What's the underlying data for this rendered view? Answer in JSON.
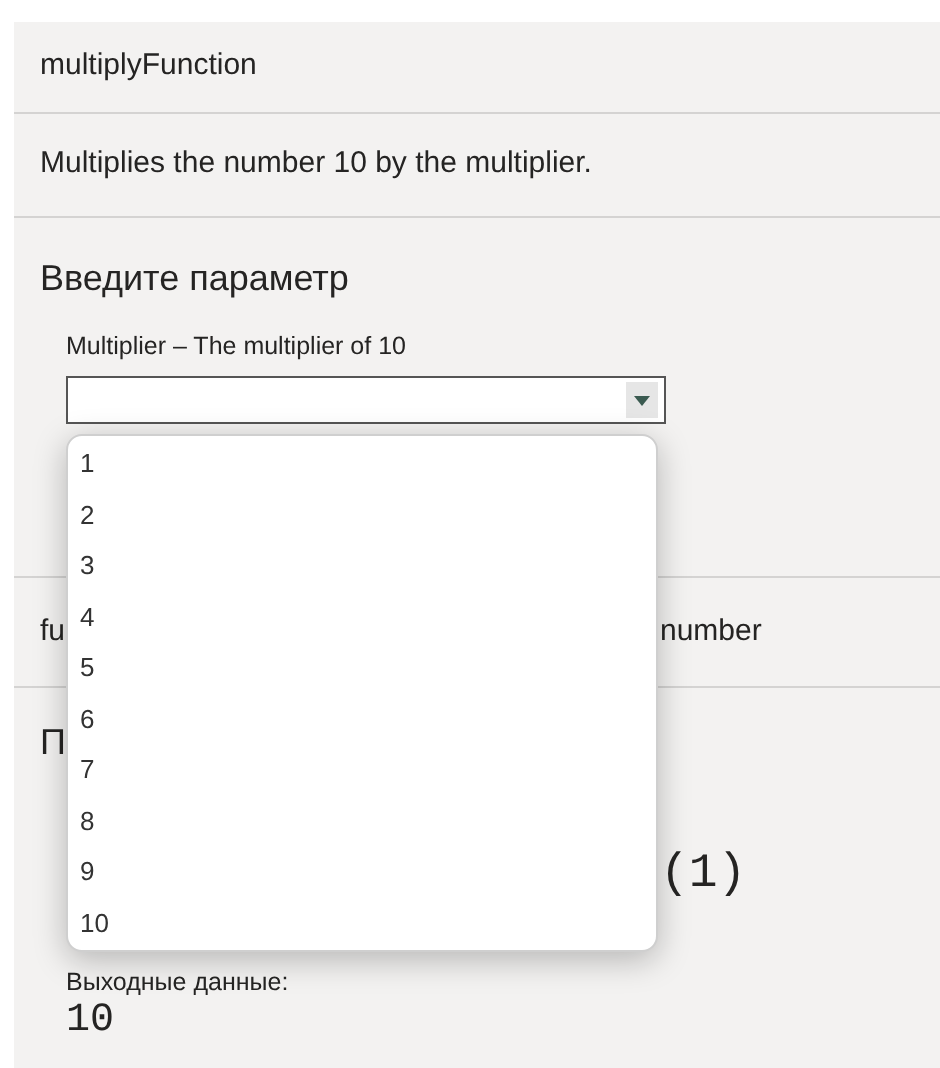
{
  "function_name": "multiplyFunction",
  "description": "Multiplies the number 10 by the multiplier.",
  "parameter_section": {
    "heading": "Введите параметр",
    "field_label": "Multiplier – The multiplier of 10",
    "dropdown": {
      "expanded": true,
      "options": [
        "1",
        "2",
        "3",
        "4",
        "5",
        "6",
        "7",
        "8",
        "9",
        "10"
      ]
    }
  },
  "function_row": {
    "left_text": "fu",
    "right_text": "number"
  },
  "result_section": {
    "heading": "П",
    "call_text": "(1)",
    "output_label": "Выходные данные:",
    "output_value": "10"
  }
}
